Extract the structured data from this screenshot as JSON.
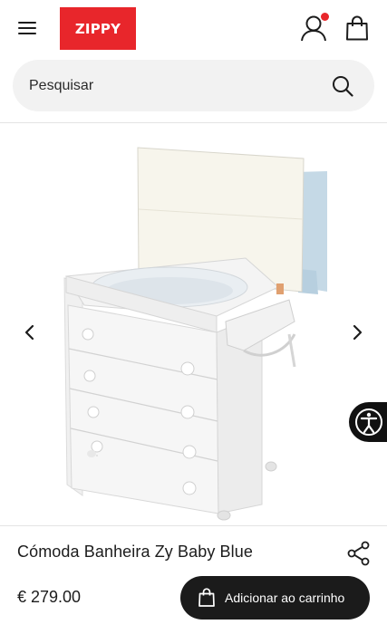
{
  "header": {
    "logo_text": "ZIPPY",
    "brand_color": "#e8262b",
    "icons": [
      "menu-icon",
      "user-icon",
      "notification-dot",
      "shopping-bag-icon"
    ]
  },
  "search": {
    "placeholder": "Pesquisar",
    "icon": "search-icon"
  },
  "gallery": {
    "prev_icon": "chevron-left-icon",
    "next_icon": "chevron-right-icon"
  },
  "accessibility": {
    "icon": "accessibility-icon"
  },
  "product": {
    "title": "Cómoda Banheira Zy Baby Blue",
    "price": "€ 279.00",
    "share_icon": "share-icon",
    "add_to_cart_label": "Adicionar ao carrinho"
  }
}
